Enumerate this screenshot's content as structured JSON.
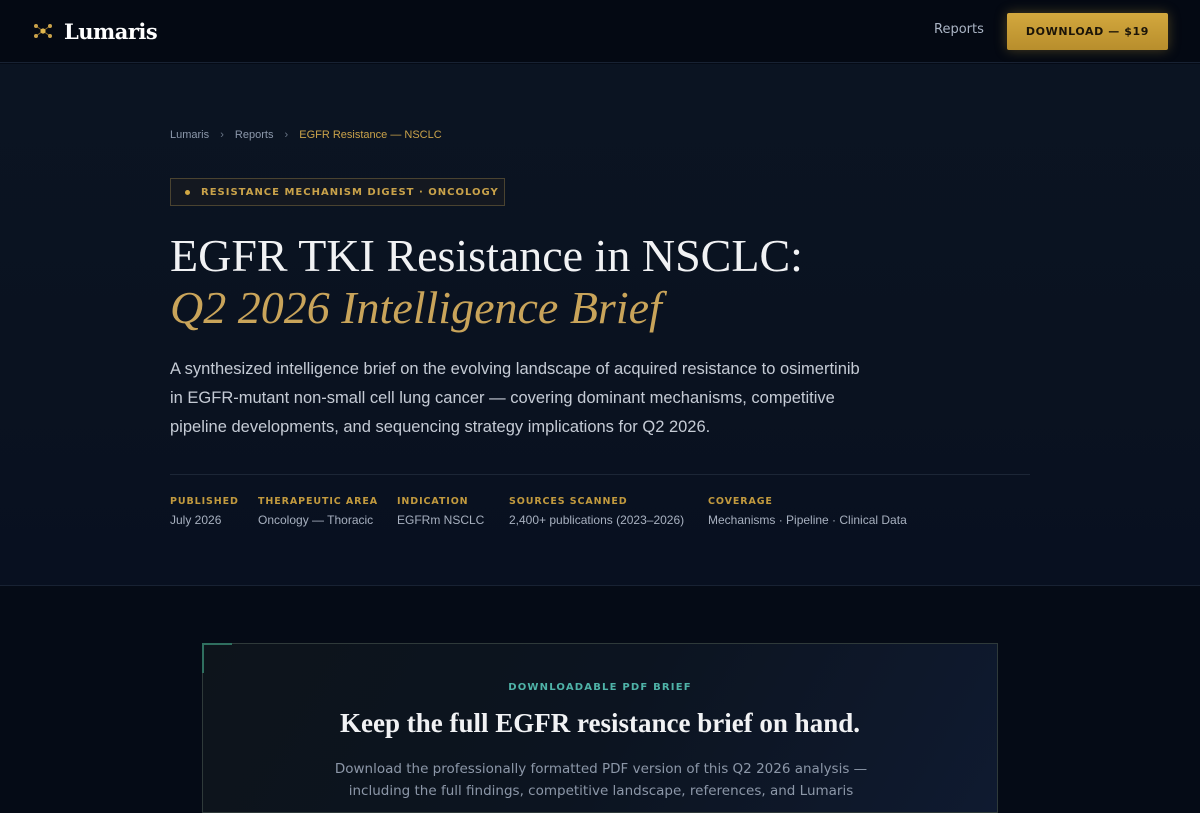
{
  "header": {
    "brand": "Lumaris",
    "logo_icon": "constellation-icon",
    "nav": {
      "reports": "Reports"
    },
    "cta_label": "DOWNLOAD — $19",
    "accent_color": "#c9a24a"
  },
  "breadcrumb": {
    "items": [
      "Lumaris",
      "Reports"
    ],
    "separator": "›",
    "current": "EGFR Resistance — NSCLC"
  },
  "hero": {
    "badge": "RESISTANCE MECHANISM DIGEST · ONCOLOGY",
    "title_line1": "EGFR TKI Resistance in NSCLC:",
    "title_line2": "Q2 2026 Intelligence Brief",
    "intro": "A synthesized intelligence brief on the evolving landscape of acquired resistance to osimertinib in EGFR-mutant non-small cell lung cancer — covering dominant mechanisms, competitive pipeline developments, and sequencing strategy implications for Q2 2026.",
    "meta": [
      {
        "label": "PUBLISHED",
        "value": "July 2026"
      },
      {
        "label": "THERAPEUTIC AREA",
        "value": "Oncology — Thoracic"
      },
      {
        "label": "INDICATION",
        "value": "EGFRm NSCLC"
      },
      {
        "label": "SOURCES SCANNED",
        "value": "2,400+ publications (2023–2026)"
      },
      {
        "label": "COVERAGE",
        "value": "Mechanisms · Pipeline · Clinical Data"
      }
    ]
  },
  "download_card": {
    "eyebrow": "DOWNLOADABLE PDF BRIEF",
    "heading": "Keep the full EGFR resistance brief on hand.",
    "description": "Download the professionally formatted PDF version of this Q2 2026 analysis — including the full findings, competitive landscape, references, and Lumaris"
  }
}
